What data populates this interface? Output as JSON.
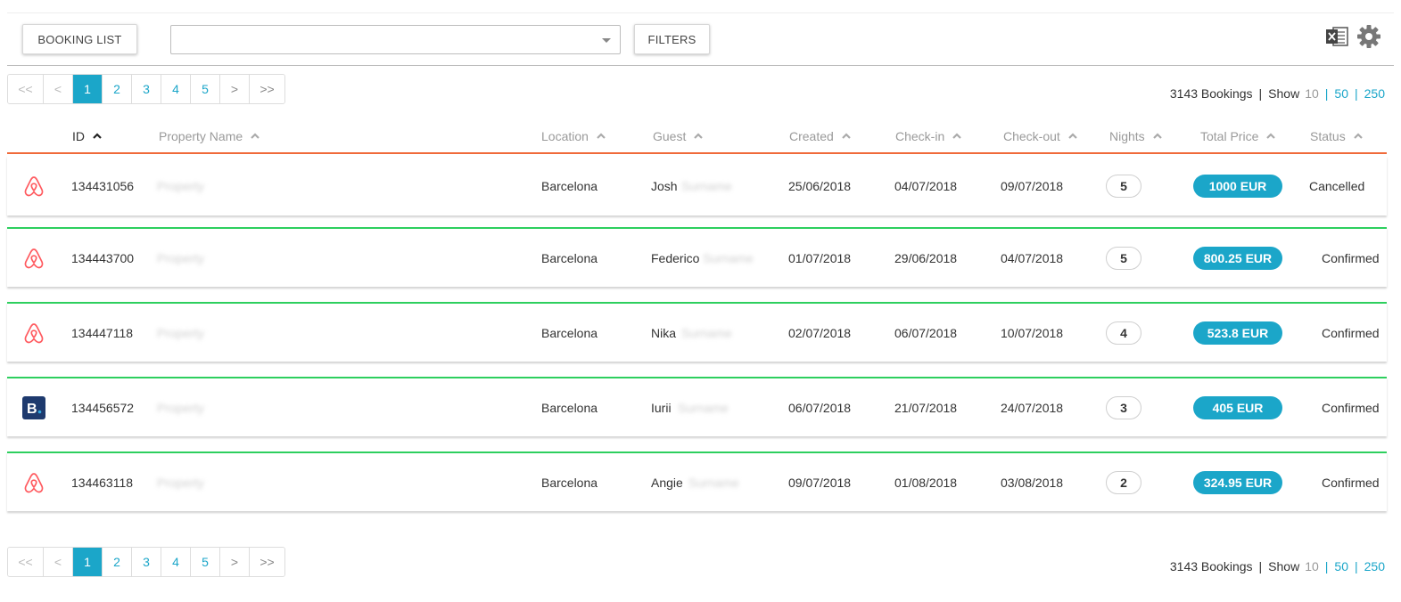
{
  "toolbar": {
    "booking_list_label": "BOOKING LIST",
    "filters_label": "FILTERS",
    "search_value": "",
    "export_icon": "excel-icon",
    "settings_icon": "gear-icon"
  },
  "pagination": {
    "first": "<<",
    "prev": "<",
    "pages": [
      "1",
      "2",
      "3",
      "4",
      "5"
    ],
    "active_page": "1",
    "next": ">",
    "last": ">>"
  },
  "summary": {
    "count_text": "3143 Bookings",
    "separator": "|",
    "show_label": "Show",
    "page_sizes": [
      "10",
      "50",
      "250"
    ],
    "current_size": "10"
  },
  "table": {
    "columns": [
      "ID",
      "Property Name",
      "Location",
      "Guest",
      "Created",
      "Check-in",
      "Check-out",
      "Nights",
      "Total Price",
      "Status"
    ],
    "rows": [
      {
        "source": "airbnb",
        "id": "134431056",
        "property": "Property",
        "location": "Barcelona",
        "guest_first": "Josh",
        "guest_last": "Surname",
        "created": "25/06/2018",
        "checkin": "04/07/2018",
        "checkout": "09/07/2018",
        "nights": "5",
        "price": "1000 EUR",
        "status": "Cancelled"
      },
      {
        "source": "airbnb",
        "id": "134443700",
        "property": "Property",
        "location": "Barcelona",
        "guest_first": "Federico",
        "guest_last": "Surname",
        "created": "01/07/2018",
        "checkin": "29/06/2018",
        "checkout": "04/07/2018",
        "nights": "5",
        "price": "800.25 EUR",
        "status": "Confirmed"
      },
      {
        "source": "airbnb",
        "id": "134447118",
        "property": "Property",
        "location": "Barcelona",
        "guest_first": "Nika",
        "guest_last": "Surname",
        "created": "02/07/2018",
        "checkin": "06/07/2018",
        "checkout": "10/07/2018",
        "nights": "4",
        "price": "523.8 EUR",
        "status": "Confirmed"
      },
      {
        "source": "booking",
        "id": "134456572",
        "property": "Property",
        "location": "Barcelona",
        "guest_first": "Iurii",
        "guest_last": "Surname",
        "created": "06/07/2018",
        "checkin": "21/07/2018",
        "checkout": "24/07/2018",
        "nights": "3",
        "price": "405 EUR",
        "status": "Confirmed"
      },
      {
        "source": "airbnb",
        "id": "134463118",
        "property": "Property",
        "location": "Barcelona",
        "guest_first": "Angie",
        "guest_last": "Surname",
        "created": "09/07/2018",
        "checkin": "01/08/2018",
        "checkout": "03/08/2018",
        "nights": "2",
        "price": "324.95 EUR",
        "status": "Confirmed"
      }
    ]
  },
  "icons": {
    "airbnb": "airbnb-icon",
    "booking": "booking-com-icon",
    "sort": "chevron-up-icon"
  },
  "colors": {
    "accent": "#1ba6c9",
    "confirmed_border": "#2dcf5e",
    "header_border": "#f06a3a",
    "airbnb": "#ff5a5f",
    "booking": "#1e3a6e"
  }
}
